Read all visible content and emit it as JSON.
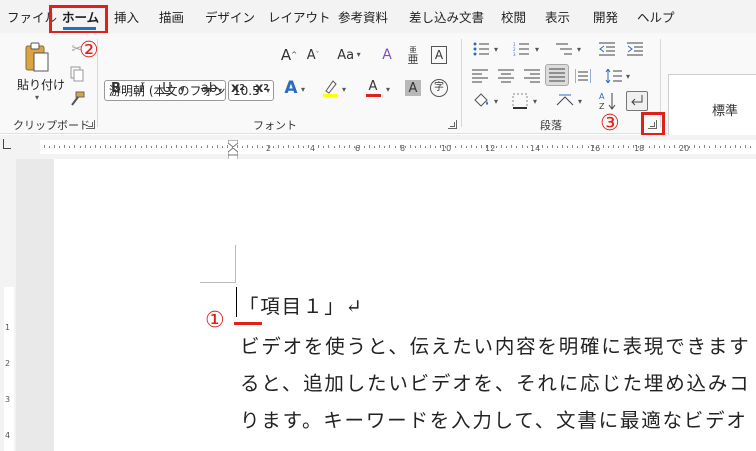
{
  "menu": {
    "tabs": [
      "ファイル",
      "ホーム",
      "挿入",
      "描画",
      "デザイン",
      "レイアウト",
      "参考資料",
      "差し込み文書",
      "校閲",
      "表示",
      "開発",
      "ヘルプ"
    ]
  },
  "ribbon": {
    "clipboard": {
      "paste_label": "貼り付け",
      "group_label": "クリップボード"
    },
    "font": {
      "font_name": "游明朝 (本文のフォン",
      "font_size": "10.5",
      "group_label": "フォント",
      "bold": "B",
      "italic": "I",
      "underline": "U",
      "strike": "ab",
      "subscript": "x",
      "subscript_mark": "2",
      "superscript": "x",
      "superscript_mark": "2",
      "grow": "A",
      "shrink": "A",
      "change_case": "Aa",
      "text_effect": "A",
      "font_color": "A",
      "char_shade": "A",
      "char_border": "A",
      "ruby_base": "亜",
      "ruby_top": "亜",
      "enclose": "字"
    },
    "paragraph": {
      "group_label": "段落"
    },
    "styles": {
      "standard": "標準"
    }
  },
  "ruler": {
    "numbers": [
      "2",
      "4",
      "6",
      "8",
      "10",
      "12",
      "14",
      "16",
      "18",
      "20"
    ]
  },
  "vruler": {
    "numbers": [
      "1",
      "2",
      "3",
      "4"
    ]
  },
  "document": {
    "lines": [
      "「項目１」↵",
      "ビデオを使うと、伝えたい内容を明確に表現できます",
      "ると、追加したいビデオを、それに応じた埋め込みコ",
      "ります。キーワードを入力して、文書に最適なビデオ",
      "、"
    ]
  },
  "annotations": {
    "step1": "①",
    "step2": "②",
    "step3": "③",
    "color": "#e0201b"
  },
  "colors": {
    "accent": "#2b6cc2",
    "highlight_yellow": "#ffff00",
    "font_red": "#e0201b"
  }
}
